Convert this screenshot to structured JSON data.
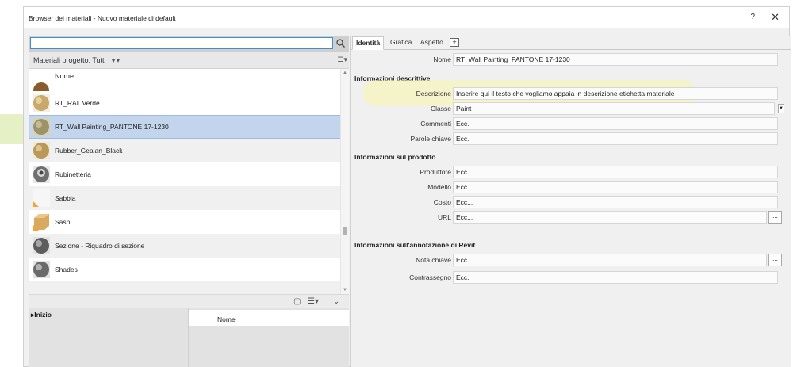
{
  "window": {
    "title": "Browser dei materiali - Nuovo materiale di default",
    "help_label": "?",
    "close_label": "✕"
  },
  "left_panel": {
    "search": {
      "value": "",
      "placeholder": ""
    },
    "filter_label": "Materiali progetto: Tutti",
    "list_header": "Nome",
    "materials": [
      {
        "name": "RT_RAL Verde",
        "thumb": "tan-sphere"
      },
      {
        "name": "RT_Wall Painting_PANTONE 17-1230",
        "thumb": "olive-sphere",
        "selected": true
      },
      {
        "name": "Rubber_Gealan_Black",
        "thumb": "tan-sphere"
      },
      {
        "name": "Rubinetteria",
        "thumb": "chrome-sphere"
      },
      {
        "name": "Sabbia",
        "thumb": "blank-swatch"
      },
      {
        "name": "Sash",
        "thumb": "wood-cube"
      },
      {
        "name": "Sezione - Riquadro di sezione",
        "thumb": "grey-sphere"
      },
      {
        "name": "Shades",
        "thumb": "grey-sphere"
      }
    ],
    "library_tree_item": "▸Inizio",
    "library_column_header": "Nome"
  },
  "right_panel": {
    "tabs": [
      "Identità",
      "Grafica",
      "Aspetto"
    ],
    "tab_add_label": "+",
    "name": {
      "label": "Nome",
      "value": "RT_Wall Painting_PANTONE 17-1230"
    },
    "section_descriptive": "Informazioni descrittive",
    "descrizione": {
      "label": "Descrizione",
      "value": "Inserire qui il testo che vogliamo appaia in descrizione etichetta materiale"
    },
    "classe": {
      "label": "Classe",
      "value": "Paint"
    },
    "commenti": {
      "label": "Commenti",
      "value": "Ecc."
    },
    "parole_chiave": {
      "label": "Parole chiave",
      "value": "Ecc."
    },
    "section_product": "Informazioni sul prodotto",
    "produttore": {
      "label": "Produttore",
      "value": "Ecc..."
    },
    "modello": {
      "label": "Modello",
      "value": "Ecc..."
    },
    "costo": {
      "label": "Costo",
      "value": "Ecc..."
    },
    "url": {
      "label": "URL",
      "value": "Ecc..."
    },
    "browse_label": "...",
    "section_revit": "Informazioni sull'annotazione di Revit",
    "nota_chiave": {
      "label": "Nota chiave",
      "value": "Ecc."
    },
    "contrassegno": {
      "label": "Contrassegno",
      "value": "Ecc."
    }
  }
}
